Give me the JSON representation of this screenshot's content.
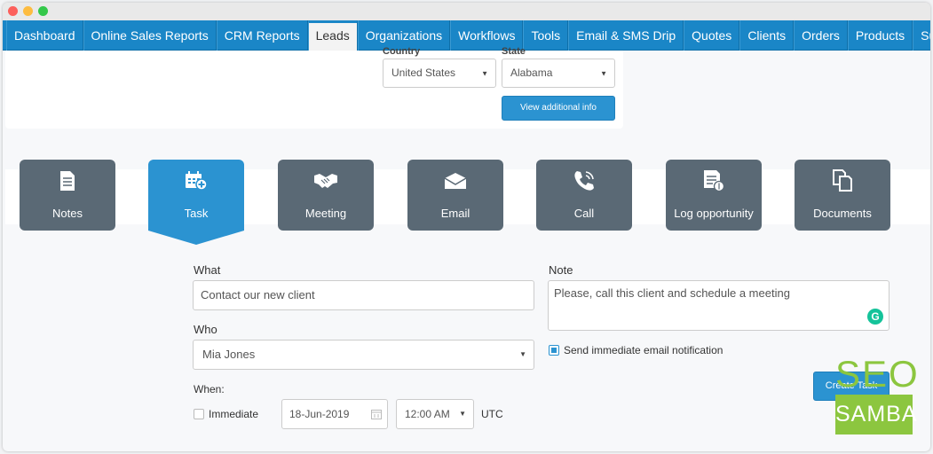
{
  "nav": {
    "items": [
      "Dashboard",
      "Online Sales Reports",
      "CRM Reports",
      "Leads",
      "Organizations",
      "Workflows",
      "Tools",
      "Email & SMS Drip",
      "Quotes",
      "Clients",
      "Orders",
      "Products",
      "Suppliers"
    ],
    "active": "Leads"
  },
  "address": {
    "country_label": "Country",
    "country_value": "United States",
    "state_label": "State",
    "state_value": "Alabama",
    "view_info_button": "View additional info"
  },
  "activity_tabs": [
    {
      "label": "Notes",
      "icon": "notes-icon"
    },
    {
      "label": "Task",
      "icon": "calendar-add-icon"
    },
    {
      "label": "Meeting",
      "icon": "handshake-icon"
    },
    {
      "label": "Email",
      "icon": "envelope-icon"
    },
    {
      "label": "Call",
      "icon": "phone-icon"
    },
    {
      "label": "Log opportunity",
      "icon": "document-money-icon"
    },
    {
      "label": "Documents",
      "icon": "documents-icon"
    }
  ],
  "active_tab": "Task",
  "task_form": {
    "what_label": "What",
    "what_value": "Contact our new client",
    "who_label": "Who",
    "who_value": "Mia Jones",
    "when_label": "When:",
    "immediate_label": "Immediate",
    "immediate_checked": false,
    "date_value": "18-Jun-2019",
    "time_value": "12:00 AM",
    "timezone": "UTC",
    "note_label": "Note",
    "note_value": "Please, call this client and schedule a meeting",
    "send_notification_label": "Send immediate email notification",
    "send_notification_checked": true,
    "create_button": "Create Task"
  },
  "watermark": {
    "top": "SEO",
    "bottom": "SAMBA"
  },
  "colors": {
    "nav_blue": "#1a86c7",
    "tab_gray": "#5a6975",
    "accent_blue": "#2b93d1",
    "logo_green": "#8cc63f"
  }
}
